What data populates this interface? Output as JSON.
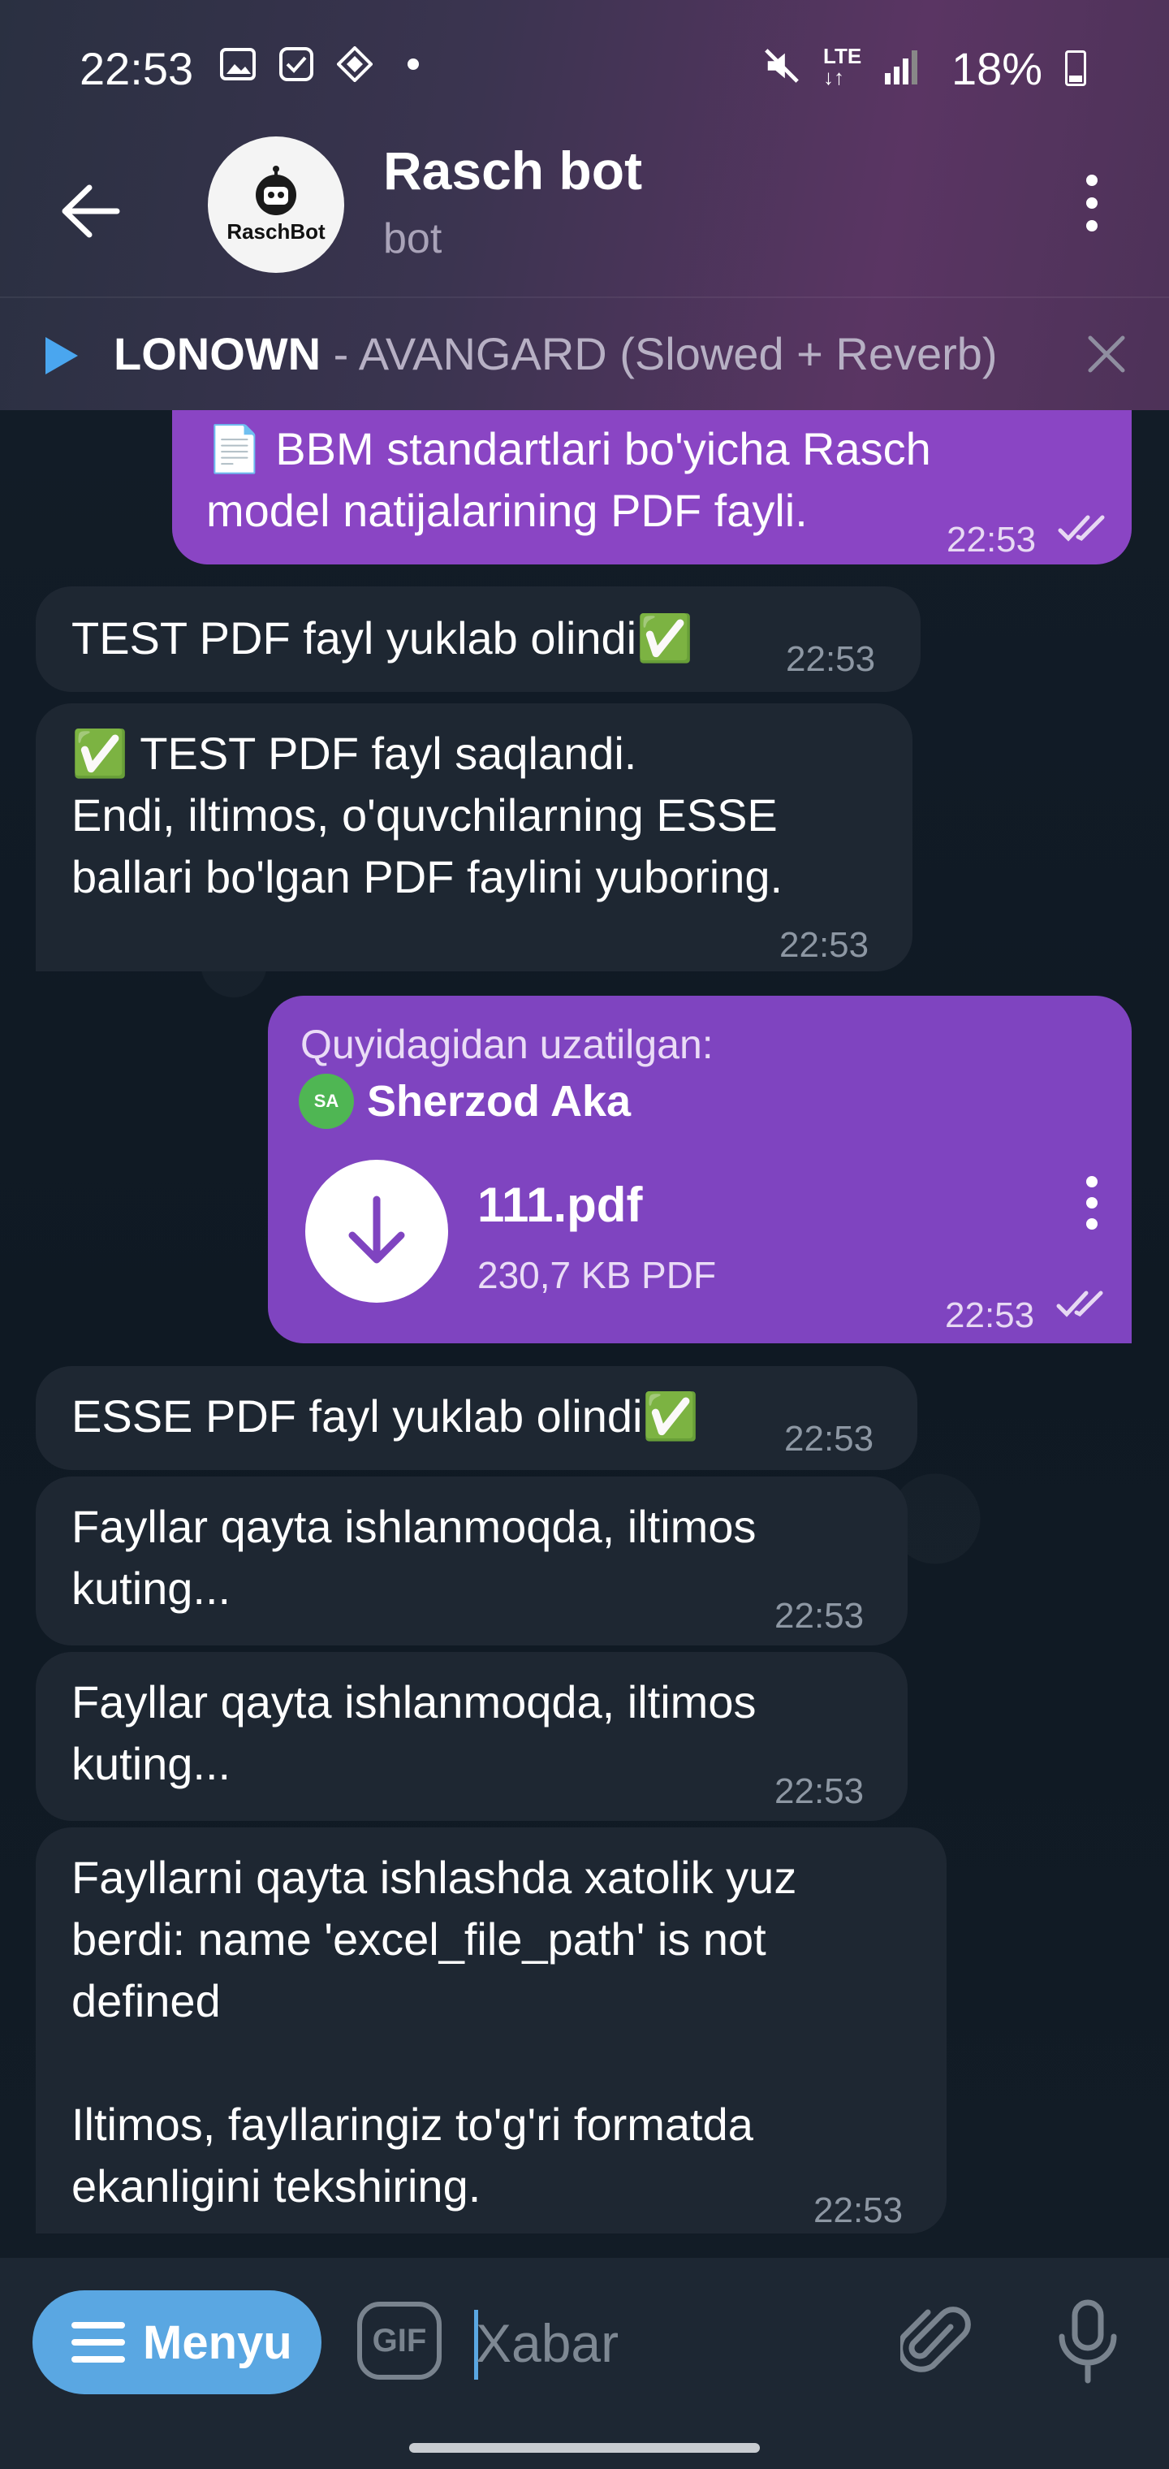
{
  "status": {
    "time": "22:53",
    "battery": "18%",
    "icons": [
      "gallery-icon",
      "checkbox-icon",
      "qr-icon",
      "dot-icon",
      "mute-icon",
      "lte-icon",
      "signal-icon",
      "battery-icon"
    ]
  },
  "header": {
    "title": "Rasch bot",
    "subtitle": "bot",
    "avatar_label": "RaschBot"
  },
  "music": {
    "artist": "LONOWN",
    "title": " - AVANGARD (Slowed + Reverb)"
  },
  "messages": [
    {
      "id": "m1",
      "dir": "out",
      "text": "📄 BBM standartlari bo'yicha Rasch\nmodel natijalarining PDF fayli.",
      "time": "22:53"
    },
    {
      "id": "m2",
      "dir": "in",
      "text": "TEST PDF fayl yuklab olindi✅",
      "time": "22:53"
    },
    {
      "id": "m3",
      "dir": "in",
      "text": "✅ TEST PDF fayl saqlandi.\nEndi, iltimos, o'quvchilarning ESSE\nballari bo'lgan PDF faylini yuboring.",
      "time": "22:53"
    },
    {
      "id": "m4",
      "dir": "out",
      "forward_label": "Quyidagidan uzatilgan:",
      "forward_from": "Sherzod Aka",
      "forward_initials": "SA",
      "file_name": "111.pdf",
      "file_meta": "230,7 KB PDF",
      "time": "22:53"
    },
    {
      "id": "m5",
      "dir": "in",
      "text": "ESSE PDF fayl yuklab olindi✅",
      "time": "22:53"
    },
    {
      "id": "m6",
      "dir": "in",
      "text": "Fayllar qayta ishlanmoqda, iltimos\nkuting...",
      "time": "22:53"
    },
    {
      "id": "m7",
      "dir": "in",
      "text": "Fayllar qayta ishlanmoqda, iltimos\nkuting...",
      "time": "22:53"
    },
    {
      "id": "m8",
      "dir": "in",
      "text": "Fayllarni qayta ishlashda xatolik yuz\nberdi: name 'excel_file_path' is not\ndefined\n\nIltimos, fayllaringiz to'g'ri formatda\nekanligini tekshiring.",
      "time": "22:53"
    }
  ],
  "bottom": {
    "menu_label": "Menyu",
    "gif_label": "GIF",
    "input_placeholder": "Xabar"
  },
  "colors": {
    "accent": "#5aa7e2",
    "outgoing_bubble": "#8a45c4",
    "incoming_bubble": "#1e2732",
    "background": "#0e1621"
  }
}
